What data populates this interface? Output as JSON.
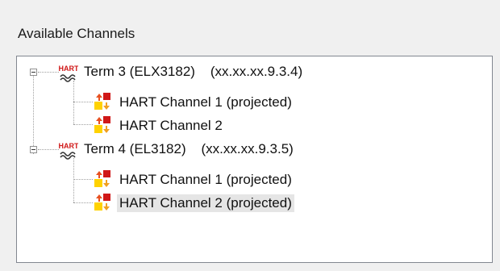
{
  "group": {
    "label": "Available Channels"
  },
  "tree": {
    "terminals": [
      {
        "badge": "HART",
        "label": "Term 3 (ELX3182)    (xx.xx.xx.9.3.4)",
        "channels": [
          {
            "label": "HART Channel 1 (projected)"
          },
          {
            "label": "HART Channel 2"
          }
        ]
      },
      {
        "badge": "HART",
        "label": "Term 4 (EL3182)    (xx.xx.xx.9.3.5)",
        "channels": [
          {
            "label": "HART Channel 1 (projected)"
          },
          {
            "label": "HART Channel 2 (projected)"
          }
        ]
      }
    ],
    "selected_item": "tree.terminals.1.channels.1"
  },
  "colors": {
    "badge_red": "#d01818",
    "icon_orange": "#f0a020",
    "icon_yellow": "#ffd200",
    "selection": "#e5e5e5"
  }
}
